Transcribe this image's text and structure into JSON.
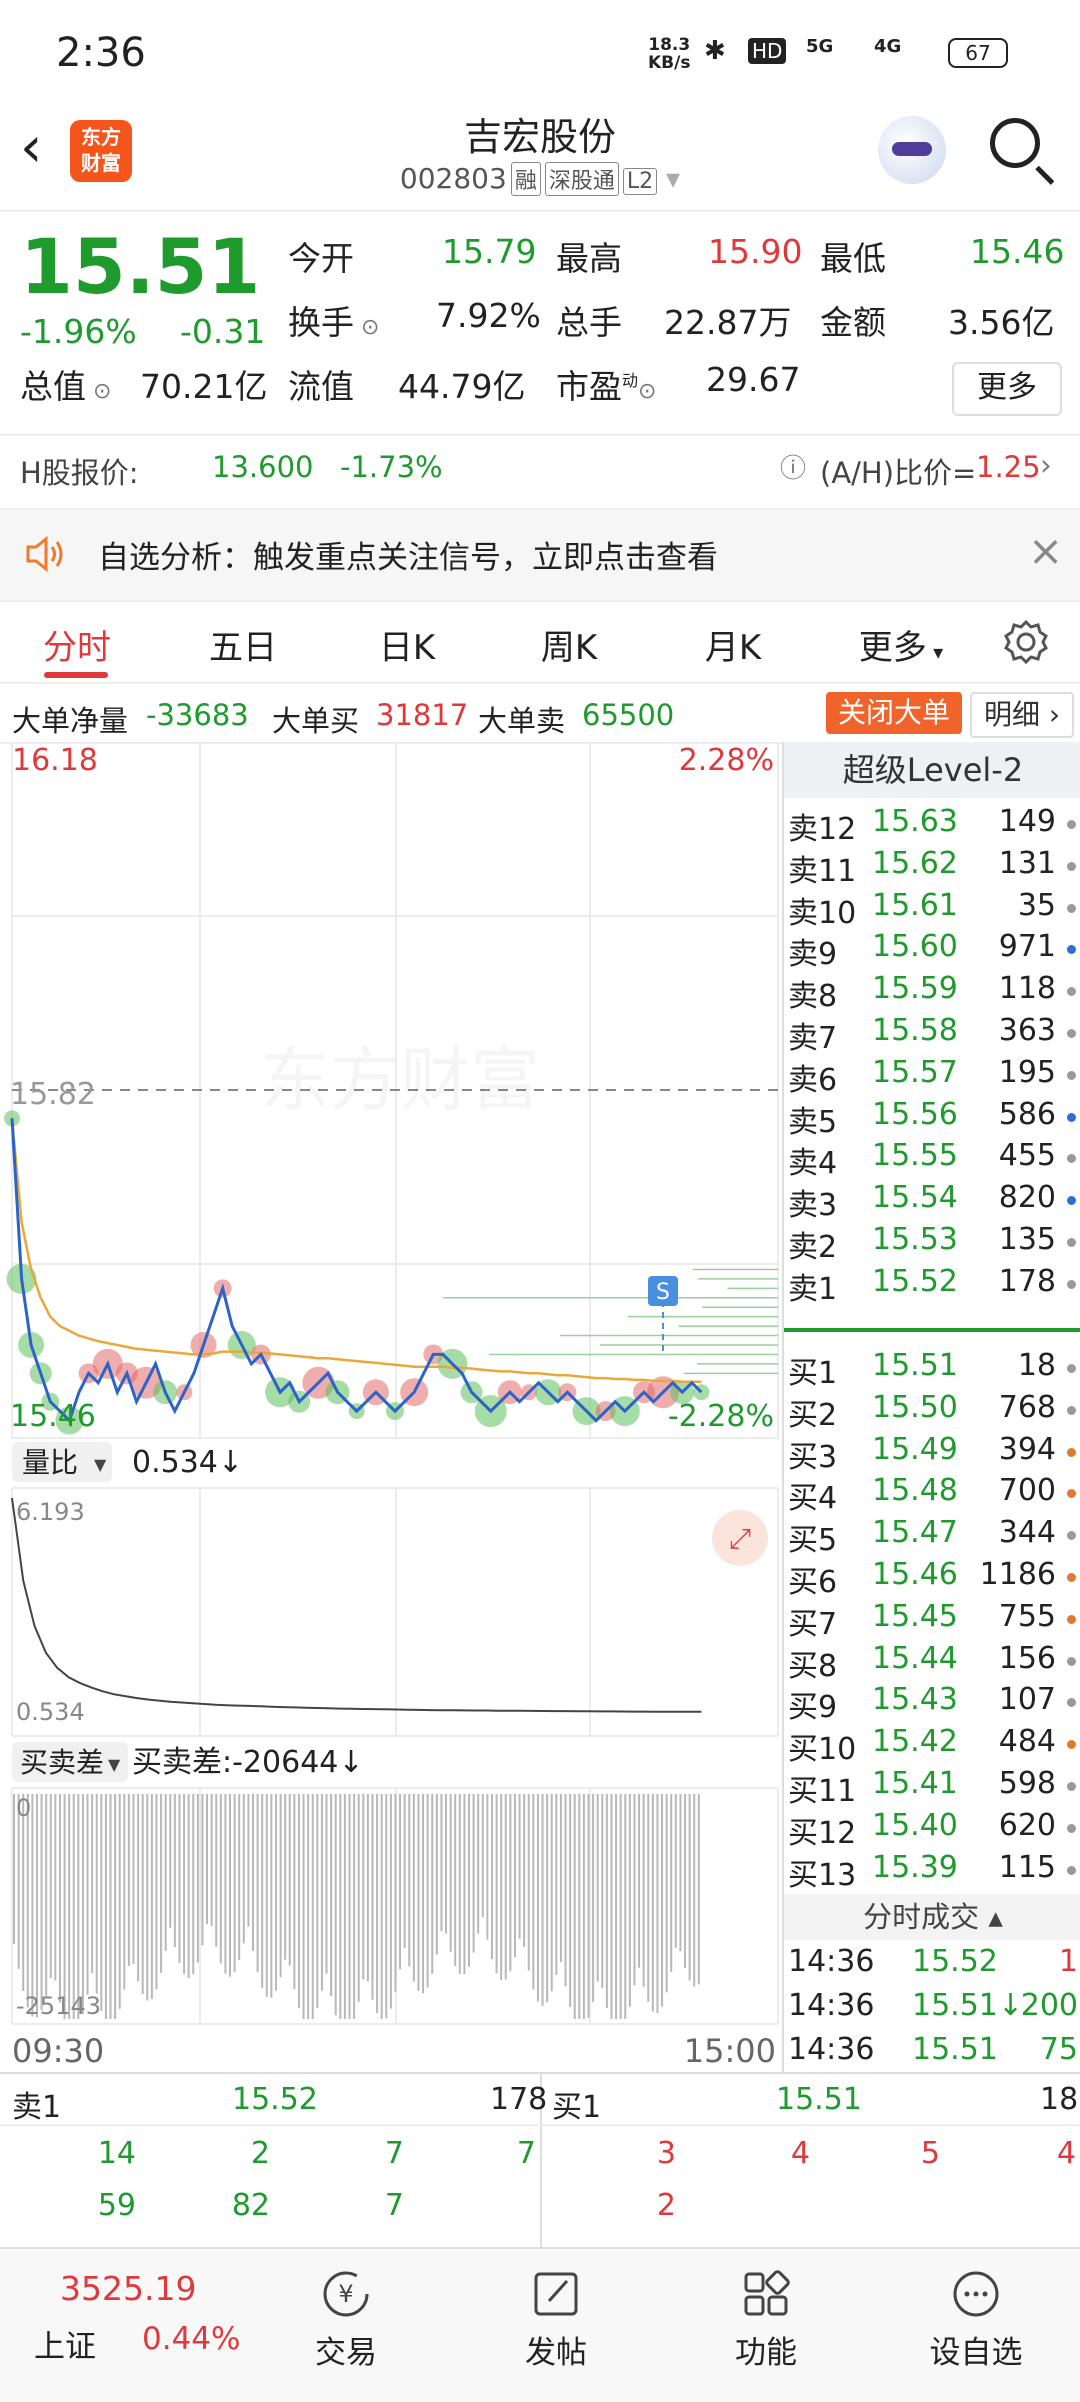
{
  "status_bar": {
    "time": "2:36",
    "net_speed_top": "18.3",
    "net_speed_unit": "KB/s",
    "hd": "HD",
    "sig5g": "5G",
    "sig4g": "4G",
    "battery": "67"
  },
  "header": {
    "logo_line1": "东方",
    "logo_line2": "财富",
    "title": "吉宏股份",
    "code": "002803",
    "tag1": "融",
    "tag2": "深股通",
    "tag3": "L2"
  },
  "quote": {
    "price": "15.51",
    "change_pct": "-1.96%",
    "change": "-0.31",
    "open_label": "今开",
    "open": "15.79",
    "high_label": "最高",
    "high": "15.90",
    "low_label": "最低",
    "low": "15.46",
    "turnover_label": "换手",
    "turnover": "7.92%",
    "volume_label": "总手",
    "volume": "22.87万",
    "amount_label": "金额",
    "amount": "3.56亿",
    "mktcap_label": "总值",
    "mktcap": "70.21亿",
    "float_label": "流值",
    "float": "44.79亿",
    "pe_label": "市盈",
    "pe_sup": "动",
    "pe": "29.67",
    "more": "更多"
  },
  "hshare": {
    "label": "H股报价:",
    "price": "13.600",
    "pct": "-1.73%",
    "ratio_label": "(A/H)比价=",
    "ratio": "1.25"
  },
  "notice": {
    "text": "自选分析：触发重点关注信号，立即点击查看"
  },
  "tabs": [
    "分时",
    "五日",
    "日K",
    "周K",
    "月K",
    "更多"
  ],
  "bigorder": {
    "net_label": "大单净量",
    "net": "-33683",
    "buy_label": "大单买",
    "buy": "31817",
    "sell_label": "大单卖",
    "sell": "65500",
    "close_btn": "关闭大单",
    "detail_btn": "明细"
  },
  "chart_data": {
    "type": "line",
    "title": "",
    "price_top": "16.18",
    "price_bottom": "15.46",
    "pct_top": "2.28%",
    "pct_bottom": "-2.28%",
    "prev_close": "15.82",
    "watermark": "东方财富",
    "x_start": "09:30",
    "x_end": "15:00",
    "ylim": [
      15.46,
      16.18
    ],
    "series": [
      {
        "values": [
          15.79,
          15.62,
          15.55,
          15.52,
          15.49,
          15.48,
          15.47,
          15.5,
          15.52,
          15.51,
          15.53,
          15.5,
          15.52,
          15.49,
          15.51,
          15.53,
          15.5,
          15.48,
          15.5,
          15.52,
          15.55,
          15.58,
          15.61,
          15.57,
          15.55,
          15.53,
          15.54,
          15.52,
          15.5,
          15.51,
          15.49,
          15.5,
          15.51,
          15.52,
          15.5,
          15.49,
          15.48,
          15.49,
          15.5,
          15.49,
          15.48,
          15.49,
          15.5,
          15.52,
          15.54,
          15.54,
          15.53,
          15.52,
          15.5,
          15.49,
          15.48,
          15.49,
          15.5,
          15.49,
          15.5,
          15.51,
          15.5,
          15.49,
          15.5,
          15.49,
          15.48,
          15.47,
          15.48,
          15.49,
          15.48,
          15.49,
          15.5,
          15.49,
          15.5,
          15.51,
          15.5,
          15.51,
          15.5
        ]
      },
      {
        "values": [
          15.79,
          15.68,
          15.63,
          15.6,
          15.58,
          15.57,
          15.565,
          15.56,
          15.557,
          15.554,
          15.552,
          15.55,
          15.548,
          15.546,
          15.545,
          15.544,
          15.543,
          15.542,
          15.541,
          15.54,
          15.54,
          15.541,
          15.543,
          15.543,
          15.543,
          15.542,
          15.542,
          15.541,
          15.54,
          15.539,
          15.538,
          15.537,
          15.536,
          15.536,
          15.535,
          15.534,
          15.533,
          15.532,
          15.531,
          15.53,
          15.529,
          15.528,
          15.527,
          15.527,
          15.527,
          15.527,
          15.526,
          15.526,
          15.525,
          15.524,
          15.523,
          15.522,
          15.522,
          15.521,
          15.52,
          15.52,
          15.519,
          15.518,
          15.518,
          15.517,
          15.516,
          15.515,
          15.515,
          15.514,
          15.514,
          15.513,
          15.513,
          15.512,
          15.512,
          15.512,
          15.511,
          15.511,
          15.511
        ]
      }
    ],
    "vol_ratio_label": "量比",
    "vol_ratio": "0.534",
    "vol_ratio_top": "6.193",
    "vol_ratio_bottom": "0.534",
    "vol_ratio_series": [
      6.193,
      4.0,
      2.8,
      2.1,
      1.7,
      1.45,
      1.3,
      1.18,
      1.08,
      1.0,
      0.95,
      0.9,
      0.86,
      0.83,
      0.8,
      0.78,
      0.76,
      0.74,
      0.72,
      0.71,
      0.7,
      0.69,
      0.68,
      0.67,
      0.66,
      0.65,
      0.64,
      0.635,
      0.63,
      0.62,
      0.615,
      0.61,
      0.605,
      0.6,
      0.595,
      0.59,
      0.585,
      0.58,
      0.578,
      0.575,
      0.572,
      0.57,
      0.568,
      0.565,
      0.562,
      0.56,
      0.558,
      0.556,
      0.554,
      0.552,
      0.55,
      0.548,
      0.546,
      0.544,
      0.542,
      0.54,
      0.539,
      0.538,
      0.537,
      0.536,
      0.535,
      0.534
    ],
    "diff_label": "买卖差",
    "diff_text": "买卖差:-20644",
    "diff_top": "0",
    "diff_bottom": "-25143"
  },
  "orderbook": {
    "title": "超级Level-2",
    "sells": [
      {
        "label": "卖12",
        "price": "15.63",
        "vol": "149",
        "dot": "#999999"
      },
      {
        "label": "卖11",
        "price": "15.62",
        "vol": "131",
        "dot": "#999999"
      },
      {
        "label": "卖10",
        "price": "15.61",
        "vol": "35",
        "dot": "#999999"
      },
      {
        "label": "卖9",
        "price": "15.60",
        "vol": "971",
        "dot": "#2b6fd6"
      },
      {
        "label": "卖8",
        "price": "15.59",
        "vol": "118",
        "dot": "#999999"
      },
      {
        "label": "卖7",
        "price": "15.58",
        "vol": "363",
        "dot": "#999999"
      },
      {
        "label": "卖6",
        "price": "15.57",
        "vol": "195",
        "dot": "#999999"
      },
      {
        "label": "卖5",
        "price": "15.56",
        "vol": "586",
        "dot": "#2b6fd6"
      },
      {
        "label": "卖4",
        "price": "15.55",
        "vol": "455",
        "dot": "#999999"
      },
      {
        "label": "卖3",
        "price": "15.54",
        "vol": "820",
        "dot": "#2b6fd6"
      },
      {
        "label": "卖2",
        "price": "15.53",
        "vol": "135",
        "dot": "#999999"
      },
      {
        "label": "卖1",
        "price": "15.52",
        "vol": "178",
        "dot": "#999999"
      }
    ],
    "buys": [
      {
        "label": "买1",
        "price": "15.51",
        "vol": "18",
        "dot": "#999999"
      },
      {
        "label": "买2",
        "price": "15.50",
        "vol": "768",
        "dot": "#999999"
      },
      {
        "label": "买3",
        "price": "15.49",
        "vol": "394",
        "dot": "#e07a2c"
      },
      {
        "label": "买4",
        "price": "15.48",
        "vol": "700",
        "dot": "#e07a2c"
      },
      {
        "label": "买5",
        "price": "15.47",
        "vol": "344",
        "dot": "#999999"
      },
      {
        "label": "买6",
        "price": "15.46",
        "vol": "1186",
        "dot": "#e07a2c"
      },
      {
        "label": "买7",
        "price": "15.45",
        "vol": "755",
        "dot": "#e07a2c"
      },
      {
        "label": "买8",
        "price": "15.44",
        "vol": "156",
        "dot": "#999999"
      },
      {
        "label": "买9",
        "price": "15.43",
        "vol": "107",
        "dot": "#999999"
      },
      {
        "label": "买10",
        "price": "15.42",
        "vol": "484",
        "dot": "#e07a2c"
      },
      {
        "label": "买11",
        "price": "15.41",
        "vol": "598",
        "dot": "#999999"
      },
      {
        "label": "买12",
        "price": "15.40",
        "vol": "620",
        "dot": "#999999"
      },
      {
        "label": "买13",
        "price": "15.39",
        "vol": "115",
        "dot": "#999999"
      }
    ],
    "trades_title": "分时成交",
    "trades": [
      {
        "time": "14:36",
        "price": "15.52",
        "vol": "1",
        "arrow": ""
      },
      {
        "time": "14:36",
        "price": "15.51",
        "vol": "200",
        "arrow": "↓"
      },
      {
        "time": "14:36",
        "price": "15.51",
        "vol": "75",
        "arrow": ""
      }
    ]
  },
  "bottom_queue": {
    "sell_label": "卖1",
    "sell_price": "15.52",
    "sell_vol": "178",
    "buy_label": "买1",
    "buy_price": "15.51",
    "buy_vol": "18",
    "sell_row1": [
      "14",
      "2",
      "7",
      "7"
    ],
    "sell_row2": [
      "59",
      "82",
      "7"
    ],
    "buy_row1": [
      "3",
      "4",
      "5",
      "4"
    ],
    "buy_row2": [
      "2"
    ]
  },
  "nav": {
    "index_value": "3525.19",
    "index_name": "上证",
    "index_pct": "0.44%",
    "trade": "交易",
    "post": "发帖",
    "func": "功能",
    "watch": "设自选"
  }
}
